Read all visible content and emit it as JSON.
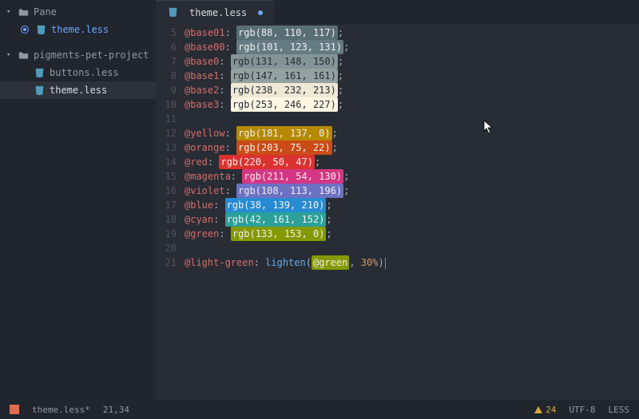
{
  "sidebar": {
    "root": {
      "label": "Pane"
    },
    "openFile": {
      "label": "theme.less"
    },
    "project": {
      "label": "pigments-pet-project"
    },
    "files": [
      {
        "label": "buttons.less"
      },
      {
        "label": "theme.less"
      }
    ]
  },
  "tab": {
    "label": "theme.less"
  },
  "gutter": {
    "start": 5,
    "end": 21
  },
  "code": [
    {
      "var": "@base01",
      "func": "rgb",
      "args": [
        88,
        110,
        117
      ],
      "swatch": "#586e75",
      "text": "dark"
    },
    {
      "var": "@base00",
      "func": "rgb",
      "args": [
        101,
        123,
        131
      ],
      "swatch": "#657b83",
      "text": "dark"
    },
    {
      "var": "@base0",
      "func": "rgb",
      "args": [
        131,
        148,
        150
      ],
      "swatch": "#839496",
      "text": "light"
    },
    {
      "var": "@base1",
      "func": "rgb",
      "args": [
        147,
        161,
        161
      ],
      "swatch": "#93a1a1",
      "text": "light"
    },
    {
      "var": "@base2",
      "func": "rgb",
      "args": [
        238,
        232,
        213
      ],
      "swatch": "#eee8d5",
      "text": "light"
    },
    {
      "var": "@base3",
      "func": "rgb",
      "args": [
        253,
        246,
        227
      ],
      "swatch": "#fdf6e3",
      "text": "light"
    },
    {
      "blank": true
    },
    {
      "var": "@yellow",
      "func": "rgb",
      "args": [
        181,
        137,
        0
      ],
      "swatch": "#b58900",
      "text": "dark"
    },
    {
      "var": "@orange",
      "func": "rgb",
      "args": [
        203,
        75,
        22
      ],
      "swatch": "#cb4b16",
      "text": "dark"
    },
    {
      "var": "@red",
      "func": "rgb",
      "args": [
        220,
        50,
        47
      ],
      "swatch": "#dc322f",
      "text": "dark"
    },
    {
      "var": "@magenta",
      "func": "rgb",
      "args": [
        211,
        54,
        130
      ],
      "swatch": "#d33682",
      "text": "dark"
    },
    {
      "var": "@violet",
      "func": "rgb",
      "args": [
        108,
        113,
        196
      ],
      "swatch": "#6c71c4",
      "text": "dark"
    },
    {
      "var": "@blue",
      "func": "rgb",
      "args": [
        38,
        139,
        210
      ],
      "swatch": "#268bd2",
      "text": "dark"
    },
    {
      "var": "@cyan",
      "func": "rgb",
      "args": [
        42,
        161,
        152
      ],
      "swatch": "#2aa198",
      "text": "dark"
    },
    {
      "var": "@green",
      "func": "rgb",
      "args": [
        133,
        153,
        0
      ],
      "swatch": "#859900",
      "text": "dark"
    },
    {
      "blank": true
    },
    {
      "var": "@light-green",
      "func": "lighten",
      "ref": "@green",
      "refSwatch": "#859900",
      "pct": "30%"
    }
  ],
  "status": {
    "filename": "theme.less*",
    "cursor": "21,34",
    "warnings": "24",
    "encoding": "UTF-8",
    "grammar": "LESS"
  }
}
